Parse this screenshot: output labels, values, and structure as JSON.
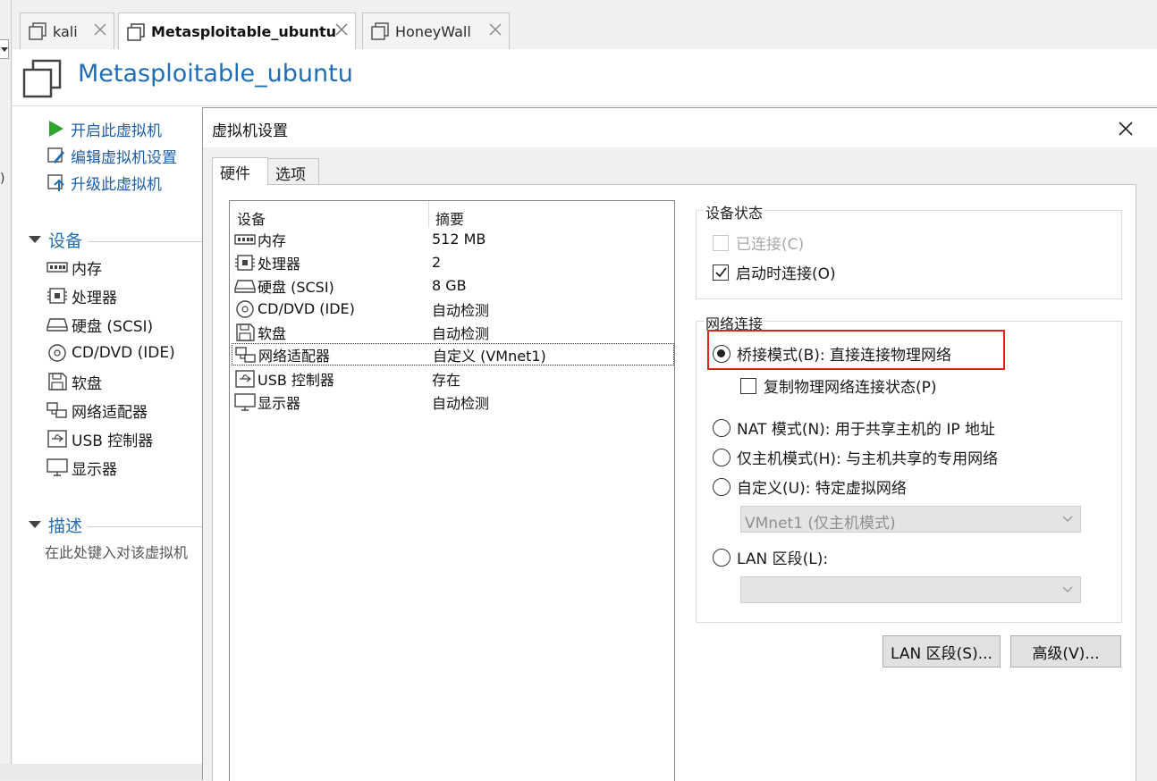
{
  "tabs": [
    {
      "label": "kali",
      "active": false
    },
    {
      "label": "Metasploitable_ubuntu",
      "active": true
    },
    {
      "label": "HoneyWall",
      "active": false
    }
  ],
  "left_fragment": ")",
  "vm": {
    "title": "Metasploitable_ubuntu",
    "actions": {
      "power_on": "开启此虚拟机",
      "edit_settings": "编辑虚拟机设置",
      "upgrade": "升级此虚拟机"
    },
    "devices_heading": "设备",
    "devices": [
      {
        "label": "内存",
        "icon": "memory-icon"
      },
      {
        "label": "处理器",
        "icon": "cpu-icon"
      },
      {
        "label": "硬盘 (SCSI)",
        "icon": "hard-disk-icon"
      },
      {
        "label": "CD/DVD (IDE)",
        "icon": "cd-dvd-icon"
      },
      {
        "label": "软盘",
        "icon": "floppy-icon"
      },
      {
        "label": "网络适配器",
        "icon": "network-adapter-icon"
      },
      {
        "label": "USB 控制器",
        "icon": "usb-icon"
      },
      {
        "label": "显示器",
        "icon": "display-icon"
      }
    ],
    "description_heading": "描述",
    "description_placeholder": "在此处键入对该虚拟机"
  },
  "dialog": {
    "title": "虚拟机设置",
    "tabs": [
      "硬件",
      "选项"
    ],
    "table": {
      "col_device": "设备",
      "col_summary": "摘要",
      "rows": [
        {
          "device": "内存",
          "summary": "512 MB"
        },
        {
          "device": "处理器",
          "summary": "2"
        },
        {
          "device": "硬盘 (SCSI)",
          "summary": "8 GB"
        },
        {
          "device": "CD/DVD (IDE)",
          "summary": "自动检测"
        },
        {
          "device": "软盘",
          "summary": "自动检测"
        },
        {
          "device": "网络适配器",
          "summary": "自定义 (VMnet1)",
          "selected": true
        },
        {
          "device": "USB 控制器",
          "summary": "存在"
        },
        {
          "device": "显示器",
          "summary": "自动检测"
        }
      ]
    },
    "device_status": {
      "title": "设备状态",
      "connected": {
        "label": "已连接(C)",
        "checked": false,
        "enabled": false
      },
      "connect_at_power_on": {
        "label": "启动时连接(O)",
        "checked": true
      }
    },
    "network": {
      "title": "网络连接",
      "bridged": {
        "label": "桥接模式(B): 直接连接物理网络",
        "selected": true
      },
      "replicate": {
        "label": "复制物理网络连接状态(P)",
        "checked": false
      },
      "nat": {
        "label": "NAT 模式(N): 用于共享主机的 IP 地址",
        "selected": false
      },
      "host_only": {
        "label": "仅主机模式(H): 与主机共享的专用网络",
        "selected": false
      },
      "custom": {
        "label": "自定义(U): 特定虚拟网络",
        "selected": false
      },
      "custom_select": "VMnet1 (仅主机模式)",
      "lan_segment": {
        "label": "LAN 区段(L):",
        "selected": false
      },
      "lan_select": ""
    },
    "buttons": {
      "lan_segments": "LAN 区段(S)...",
      "advanced": "高级(V)..."
    },
    "highlight_color": "#e0241b",
    "link_color": "#1f6db5"
  }
}
